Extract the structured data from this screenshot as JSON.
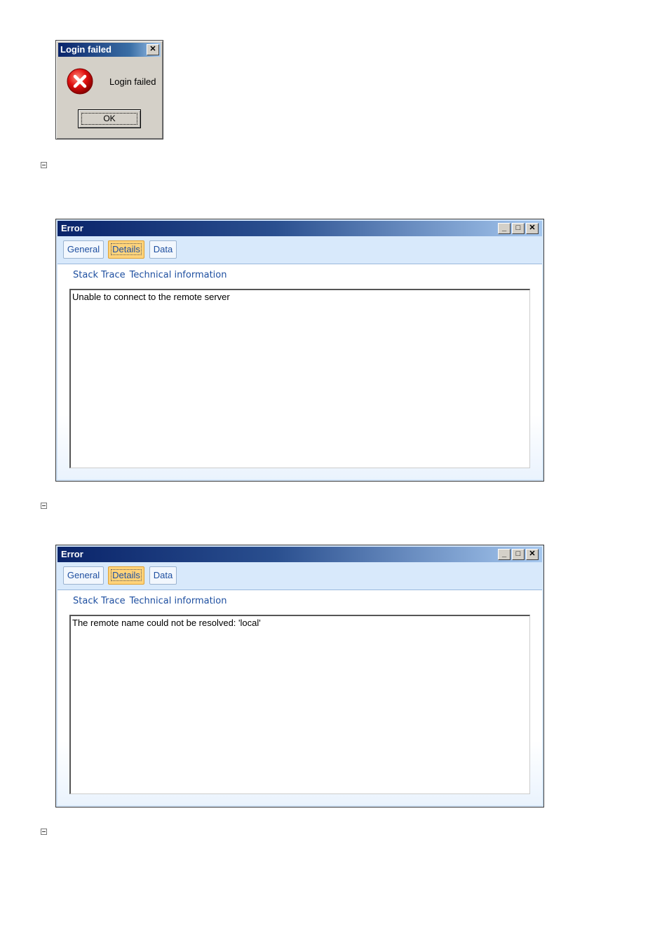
{
  "login_dialog": {
    "title": "Login failed",
    "close_glyph": "✕",
    "message": "Login failed",
    "ok_label": "OK",
    "icon": "error-icon"
  },
  "window_controls": {
    "minimize": "_",
    "maximize": "□",
    "close": "✕"
  },
  "error_windows": [
    {
      "title": "Error",
      "tabs": [
        {
          "label": "General"
        },
        {
          "label": "Details",
          "active": true
        },
        {
          "label": "Data"
        }
      ],
      "sub_tabs": [
        "Stack Trace",
        "Technical information"
      ],
      "message": "Unable to connect to the remote server"
    },
    {
      "title": "Error",
      "tabs": [
        {
          "label": "General"
        },
        {
          "label": "Details",
          "active": true
        },
        {
          "label": "Data"
        }
      ],
      "sub_tabs": [
        "Stack Trace",
        "Technical information"
      ],
      "message": "The remote name could not be resolved: 'local'"
    }
  ],
  "colors": {
    "title_start": "#0a246a",
    "tab_active": "#ffd37a",
    "link_blue": "#1e4fa0",
    "dialog_face": "#d4d0c8"
  }
}
